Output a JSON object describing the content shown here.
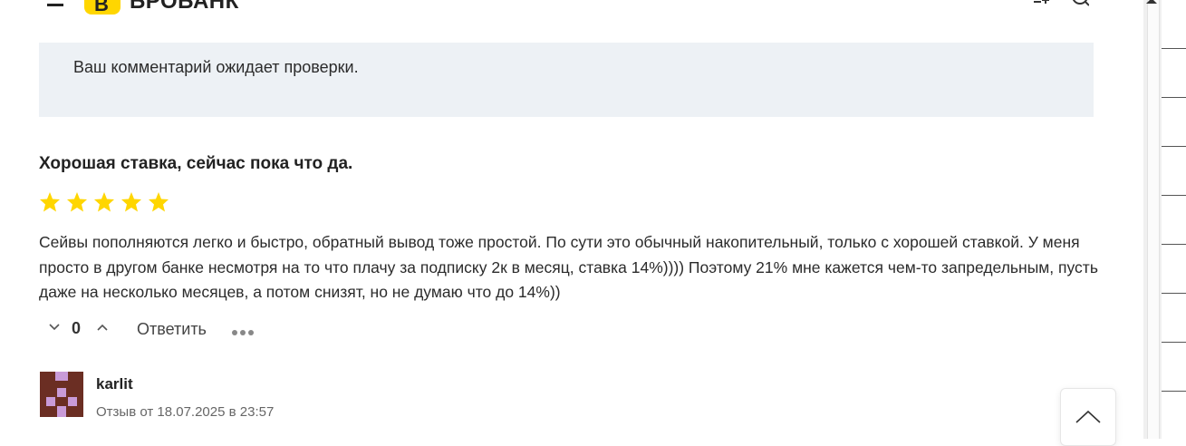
{
  "header": {
    "logo_badge": "B",
    "logo_text": "БРОБАНК",
    "icons": [
      "menu-icon",
      "compare-icon",
      "search-icon"
    ],
    "brand_color": "#ffd600"
  },
  "notice": {
    "text": "Ваш комментарий ожидает проверки.",
    "background": "#edf1f5"
  },
  "review": {
    "title": "Хорошая ставка, сейчас пока что да.",
    "rating": 5,
    "rating_max": 5,
    "star_color": "#ffd600",
    "body": "Сейвы пополняются легко и быстро, обратный вывод тоже простой. По сути это обычный накопительный, только с хорошей ставкой. У меня просто в другом банке несмотря на то что плачу за подписку 2к в месяц, ставка 14%)))) Поэтому 21% мне кажется чем-то запредельным, пусть даже на несколько месяцев, а потом снизят, но не думаю что до 14%))",
    "vote_count": "0",
    "reply_label": "Ответить"
  },
  "next_review": {
    "author": "karlit",
    "date": "Отзыв от 18.07.2025 в 23:57",
    "avatar_colors": [
      "#6b2e23",
      "#c99bd8"
    ]
  },
  "scroll_to_top": {
    "icon": "chevron-up-icon"
  }
}
